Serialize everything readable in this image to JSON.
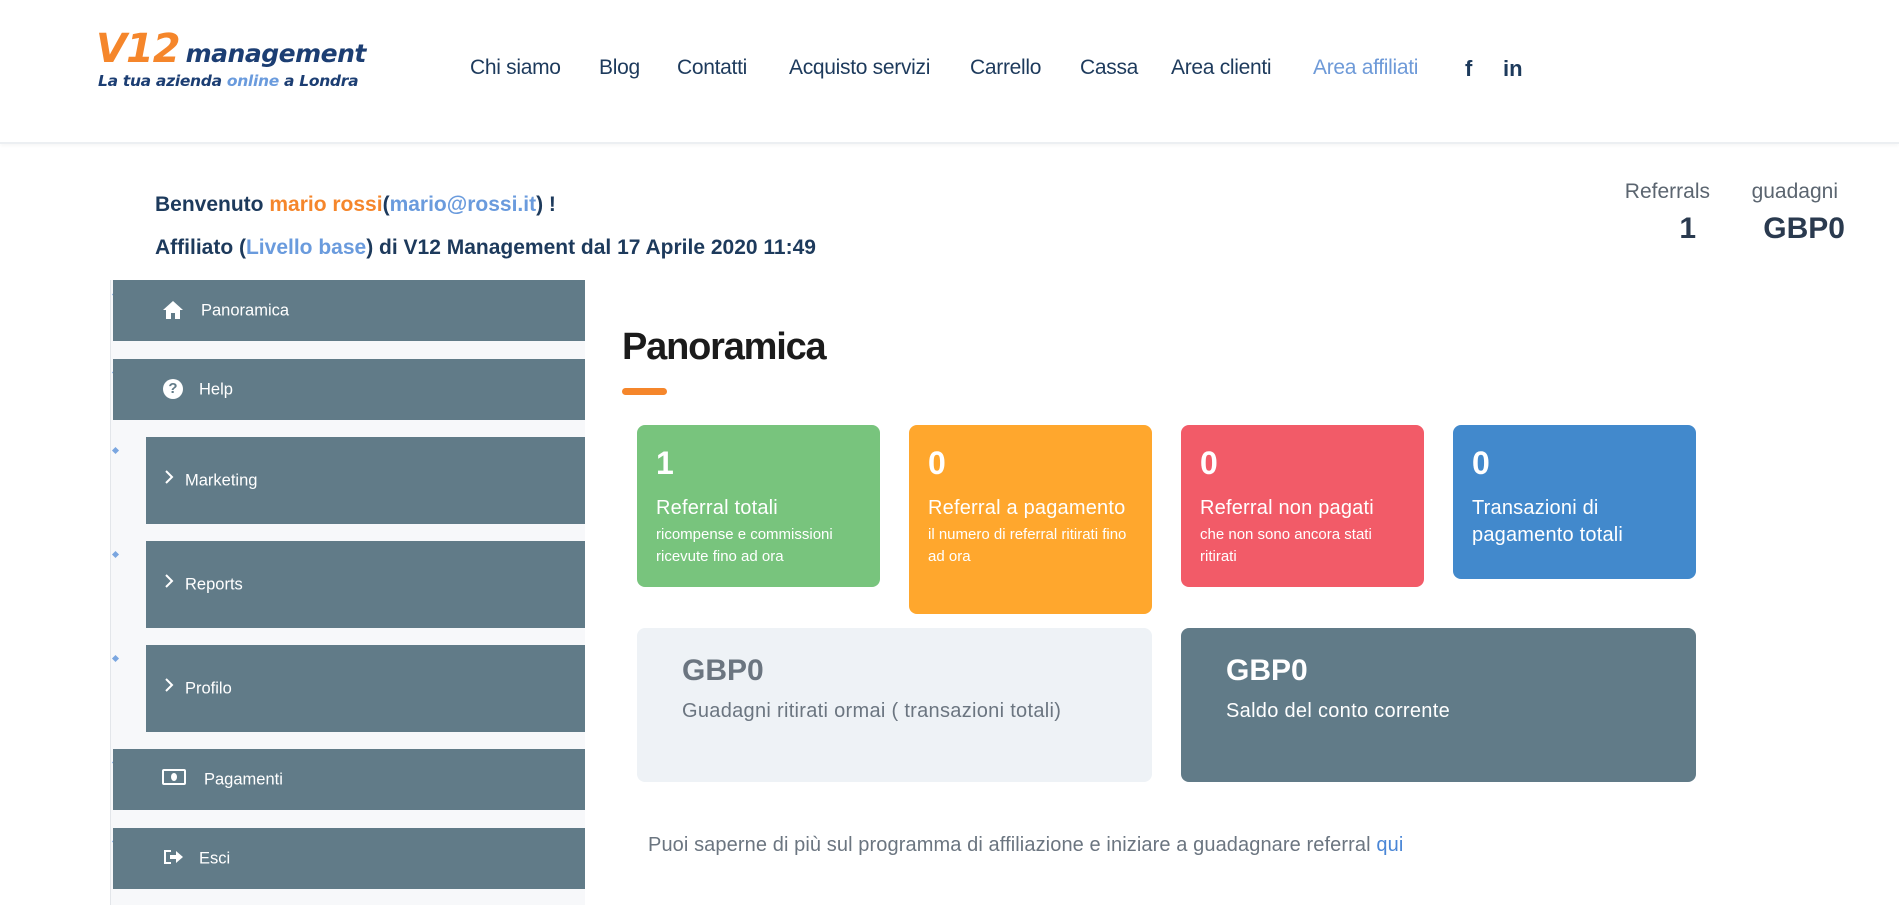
{
  "logo": {
    "v12": "V12",
    "management": "management",
    "tagline_pre": "La tua azienda",
    "tagline_accent": "online",
    "tagline_post": "a Londra"
  },
  "nav": {
    "items": [
      {
        "label": "Chi siamo"
      },
      {
        "label": "Blog"
      },
      {
        "label": "Contatti"
      },
      {
        "label": "Acquisto servizi"
      },
      {
        "label": "Carrello"
      },
      {
        "label": "Cassa"
      },
      {
        "label": "Area clienti"
      },
      {
        "label": "Area affiliati",
        "active": true
      }
    ],
    "social": {
      "facebook": "f",
      "linkedin": "in"
    }
  },
  "welcome": {
    "pre": "Benvenuto",
    "name": "mario rossi",
    "open": "(",
    "email": "mario@rossi.it",
    "close": ") !",
    "affiliate_pre": "Affiliato (",
    "level": "Livello base",
    "affiliate_post": ") di V12 Management dal 17 Aprile 2020 11:49"
  },
  "stats": {
    "referrals_label": "Referrals",
    "referrals_value": "1",
    "earnings_label": "guadagni",
    "earnings_value": "GBP0"
  },
  "sidebar": {
    "items": [
      {
        "label": "Panoramica",
        "icon": "home-icon"
      },
      {
        "label": "Help",
        "icon": "help-icon"
      },
      {
        "label": "Marketing",
        "icon": "chevron-right-icon"
      },
      {
        "label": "Reports",
        "icon": "chevron-right-icon"
      },
      {
        "label": "Profilo",
        "icon": "chevron-right-icon"
      },
      {
        "label": "Pagamenti",
        "icon": "money-icon"
      },
      {
        "label": "Esci",
        "icon": "logout-icon"
      }
    ]
  },
  "main": {
    "title": "Panoramica",
    "cards": [
      {
        "number": "1",
        "title": "Referral totali",
        "subtitle": "ricompense e commissioni ricevute fino ad ora",
        "color": "#78c47d"
      },
      {
        "number": "0",
        "title": "Referral a pagamento",
        "subtitle": "il numero di referral ritirati fino ad ora",
        "color": "#ffa72d"
      },
      {
        "number": "0",
        "title": "Referral non pagati",
        "subtitle": "che non sono ancora stati ritirati",
        "color": "#f25b68"
      },
      {
        "number": "0",
        "title": "Transazioni di pagamento totali",
        "subtitle": "",
        "color": "#4289cc"
      }
    ],
    "big_cards": [
      {
        "value": "GBP0",
        "label": "Guadagni ritirati ormai ( transazioni totali)"
      },
      {
        "value": "GBP0",
        "label": "Saldo del conto corrente"
      }
    ],
    "footer_text": "Puoi saperne di più sul programma di affiliazione e iniziare a guadagnare referral",
    "footer_link": "qui"
  }
}
